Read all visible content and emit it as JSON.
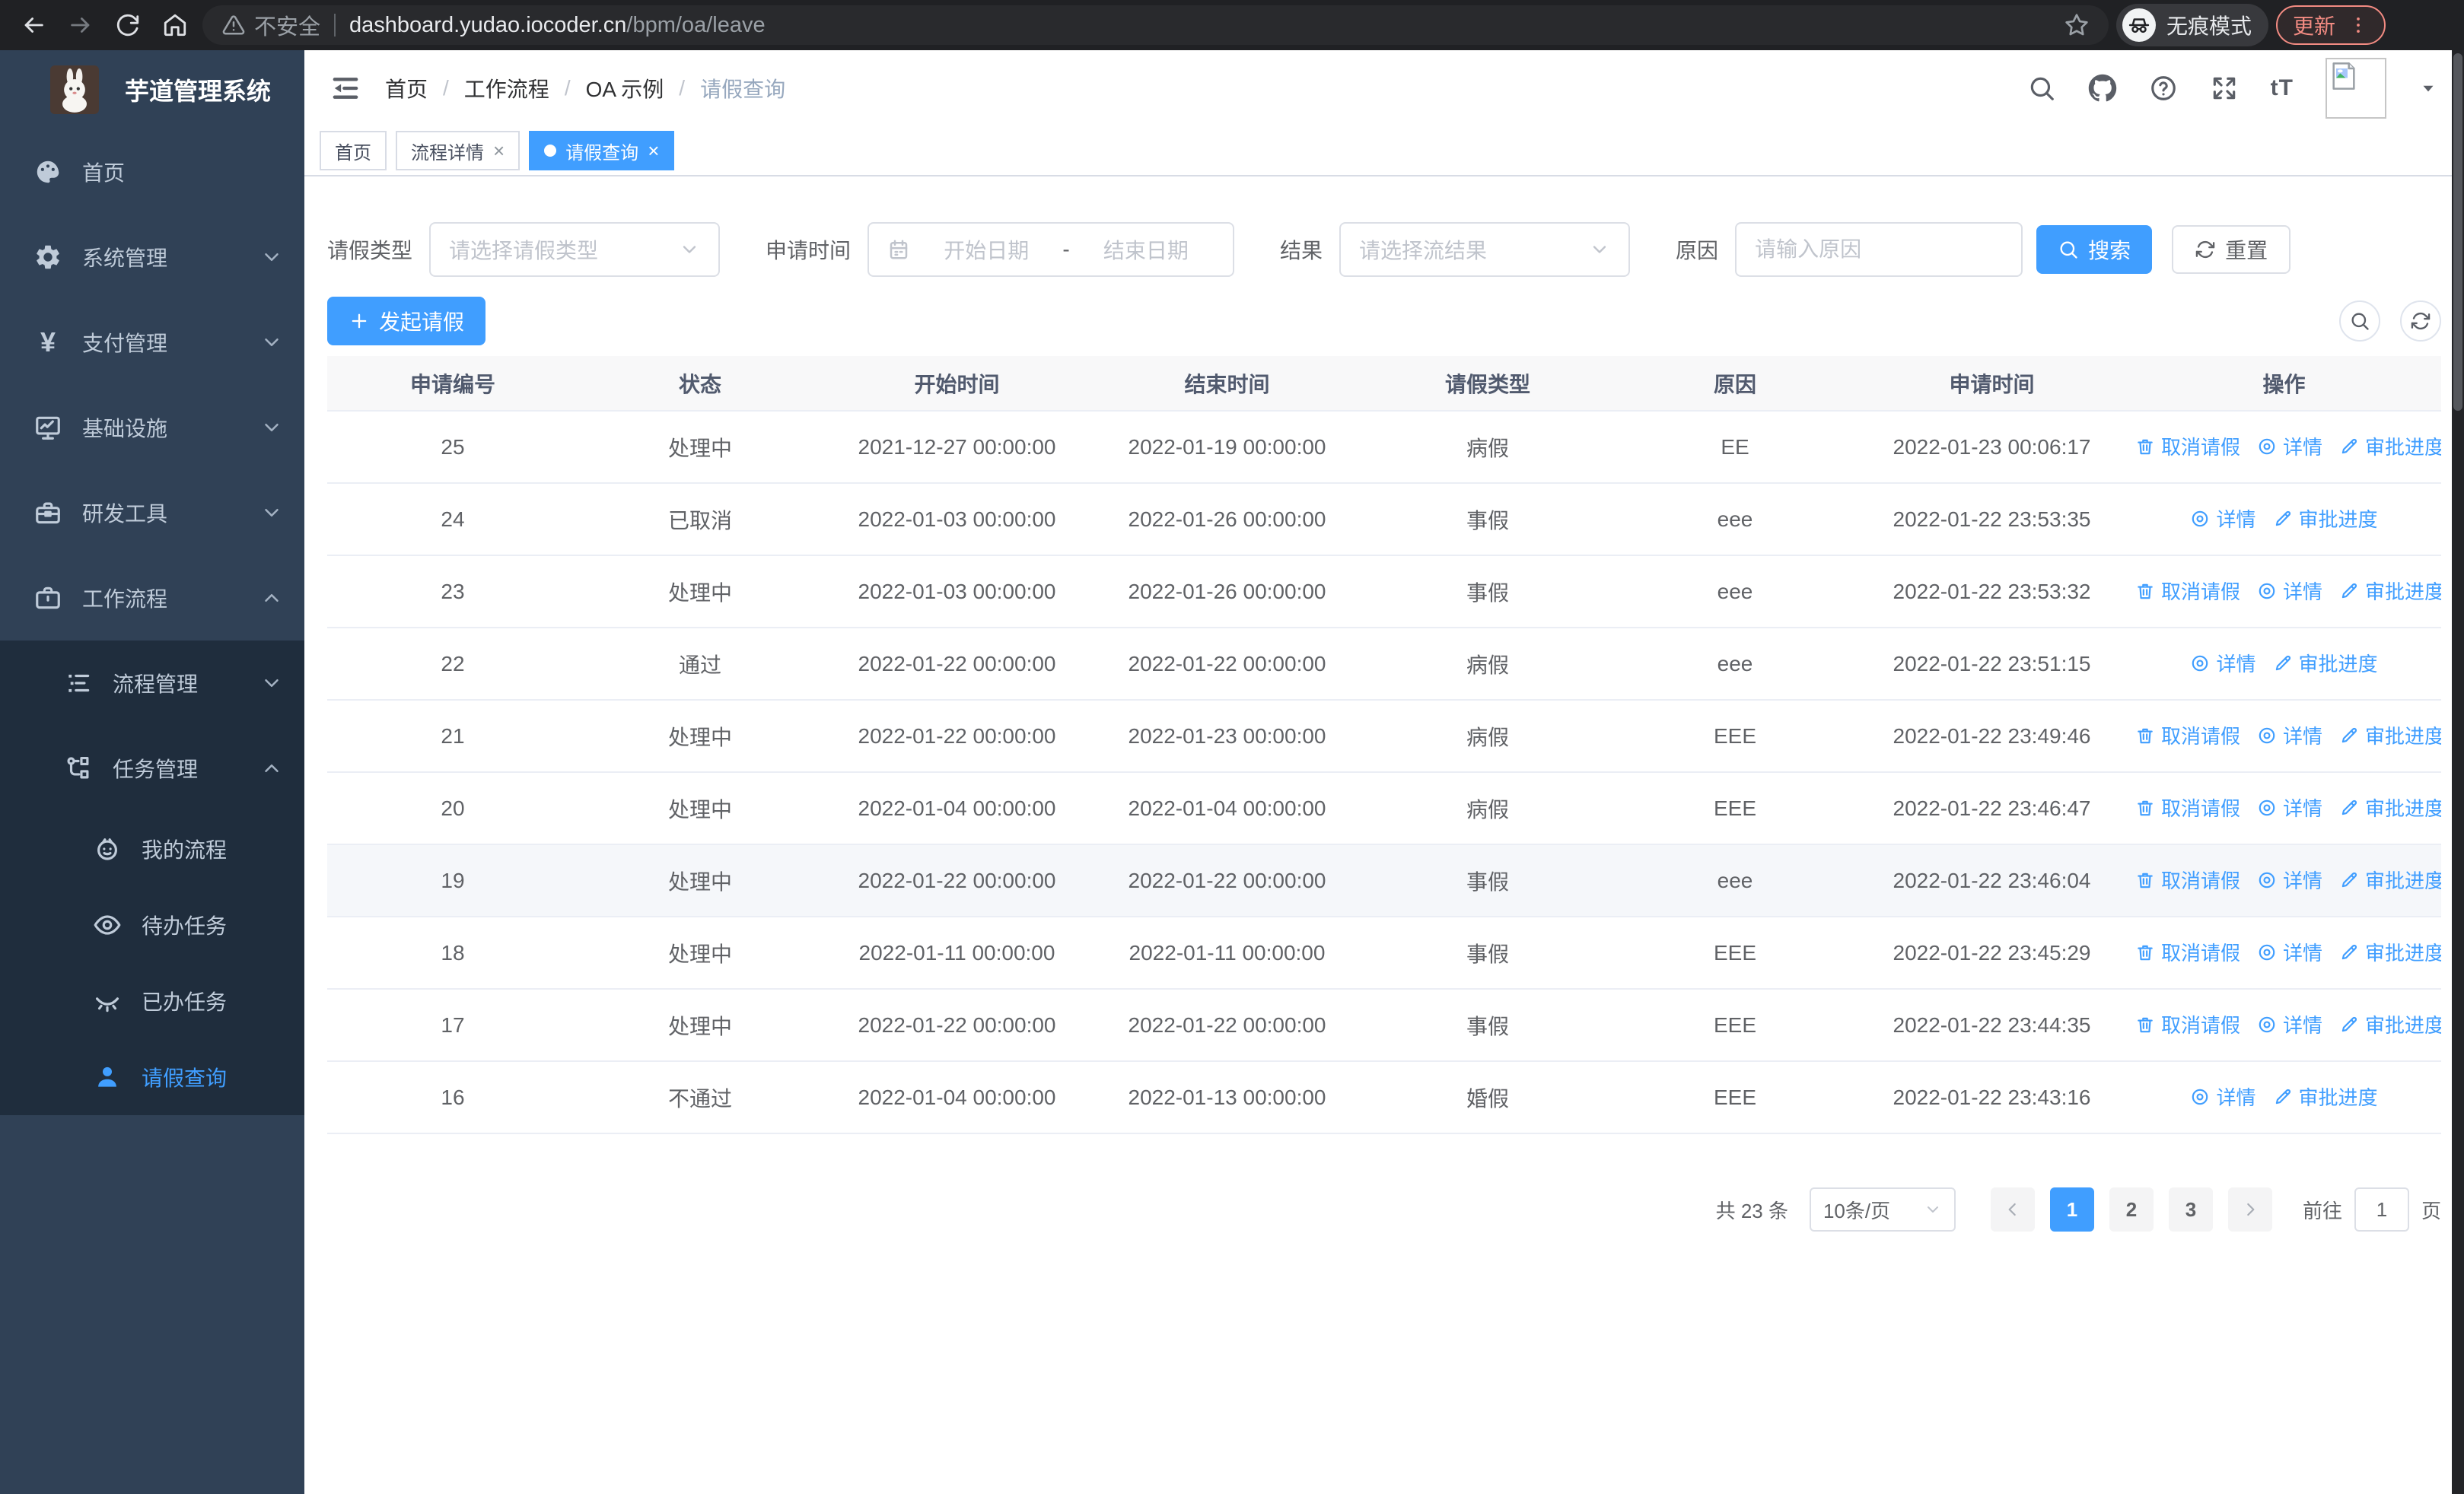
{
  "browser": {
    "security_label": "不安全",
    "url_host": "dashboard.yudao.iocoder.cn",
    "url_path": "/bpm/oa/leave",
    "incognito_label": "无痕模式",
    "update_label": "更新"
  },
  "sidebar": {
    "logo_title": "芋道管理系统",
    "menu": [
      {
        "key": "home",
        "label": "首页",
        "icon": "dashboard-icon",
        "level": 1
      },
      {
        "key": "system-management",
        "label": "系统管理",
        "icon": "gear-icon",
        "level": 1,
        "chevron": "down"
      },
      {
        "key": "payment-management",
        "label": "支付管理",
        "icon": "yen-icon",
        "level": 1,
        "chevron": "down"
      },
      {
        "key": "infrastructure",
        "label": "基础设施",
        "icon": "monitor-icon",
        "level": 1,
        "chevron": "down"
      },
      {
        "key": "dev-tools",
        "label": "研发工具",
        "icon": "toolbox-icon",
        "level": 1,
        "chevron": "down"
      },
      {
        "key": "workflow",
        "label": "工作流程",
        "icon": "briefcase-icon",
        "level": 1,
        "chevron": "up"
      },
      {
        "key": "process-management",
        "label": "流程管理",
        "icon": "list-icon",
        "level": 2,
        "chevron": "down",
        "dark": true
      },
      {
        "key": "task-management",
        "label": "任务管理",
        "icon": "flow-icon",
        "level": 2,
        "chevron": "up",
        "dark": true
      },
      {
        "key": "my-process",
        "label": "我的流程",
        "icon": "face-icon",
        "level": 3,
        "dark": true
      },
      {
        "key": "todo-tasks",
        "label": "待办任务",
        "icon": "eye-open-icon",
        "level": 3,
        "dark": true
      },
      {
        "key": "done-tasks",
        "label": "已办任务",
        "icon": "eye-closed-icon",
        "level": 3,
        "dark": true
      },
      {
        "key": "leave-query",
        "label": "请假查询",
        "icon": "user-icon",
        "level": 3,
        "dark": true,
        "active": true
      }
    ]
  },
  "breadcrumb": [
    "首页",
    "工作流程",
    "OA 示例",
    "请假查询"
  ],
  "tabs": [
    {
      "key": "home",
      "label": "首页",
      "closable": false,
      "active": false
    },
    {
      "key": "process-detail",
      "label": "流程详情",
      "closable": true,
      "active": false
    },
    {
      "key": "leave-query",
      "label": "请假查询",
      "closable": true,
      "active": true
    }
  ],
  "filters": {
    "leave_type_label": "请假类型",
    "leave_type_placeholder": "请选择请假类型",
    "apply_time_label": "申请时间",
    "start_date_placeholder": "开始日期",
    "range_separator": "-",
    "end_date_placeholder": "结束日期",
    "result_label": "结果",
    "result_placeholder": "请选择流结果",
    "reason_label": "原因",
    "reason_placeholder": "请输入原因",
    "search_label": "搜索",
    "reset_label": "重置"
  },
  "toolbar": {
    "create_label": "发起请假"
  },
  "table": {
    "columns": [
      "申请编号",
      "状态",
      "开始时间",
      "结束时间",
      "请假类型",
      "原因",
      "申请时间",
      "操作"
    ],
    "action_labels": {
      "cancel": "取消请假",
      "detail": "详情",
      "progress": "审批进度"
    },
    "rows": [
      {
        "id": "25",
        "status": "处理中",
        "start": "2021-12-27 00:00:00",
        "end": "2022-01-19 00:00:00",
        "type": "病假",
        "reason": "EE",
        "applied": "2022-01-23 00:06:17",
        "actions": [
          "cancel",
          "detail",
          "progress"
        ],
        "highlight": false
      },
      {
        "id": "24",
        "status": "已取消",
        "start": "2022-01-03 00:00:00",
        "end": "2022-01-26 00:00:00",
        "type": "事假",
        "reason": "eee",
        "applied": "2022-01-22 23:53:35",
        "actions": [
          "detail",
          "progress"
        ],
        "highlight": false
      },
      {
        "id": "23",
        "status": "处理中",
        "start": "2022-01-03 00:00:00",
        "end": "2022-01-26 00:00:00",
        "type": "事假",
        "reason": "eee",
        "applied": "2022-01-22 23:53:32",
        "actions": [
          "cancel",
          "detail",
          "progress"
        ],
        "highlight": false
      },
      {
        "id": "22",
        "status": "通过",
        "start": "2022-01-22 00:00:00",
        "end": "2022-01-22 00:00:00",
        "type": "病假",
        "reason": "eee",
        "applied": "2022-01-22 23:51:15",
        "actions": [
          "detail",
          "progress"
        ],
        "highlight": false
      },
      {
        "id": "21",
        "status": "处理中",
        "start": "2022-01-22 00:00:00",
        "end": "2022-01-23 00:00:00",
        "type": "病假",
        "reason": "EEE",
        "applied": "2022-01-22 23:49:46",
        "actions": [
          "cancel",
          "detail",
          "progress"
        ],
        "highlight": false
      },
      {
        "id": "20",
        "status": "处理中",
        "start": "2022-01-04 00:00:00",
        "end": "2022-01-04 00:00:00",
        "type": "病假",
        "reason": "EEE",
        "applied": "2022-01-22 23:46:47",
        "actions": [
          "cancel",
          "detail",
          "progress"
        ],
        "highlight": false
      },
      {
        "id": "19",
        "status": "处理中",
        "start": "2022-01-22 00:00:00",
        "end": "2022-01-22 00:00:00",
        "type": "事假",
        "reason": "eee",
        "applied": "2022-01-22 23:46:04",
        "actions": [
          "cancel",
          "detail",
          "progress"
        ],
        "highlight": true
      },
      {
        "id": "18",
        "status": "处理中",
        "start": "2022-01-11 00:00:00",
        "end": "2022-01-11 00:00:00",
        "type": "事假",
        "reason": "EEE",
        "applied": "2022-01-22 23:45:29",
        "actions": [
          "cancel",
          "detail",
          "progress"
        ],
        "highlight": false
      },
      {
        "id": "17",
        "status": "处理中",
        "start": "2022-01-22 00:00:00",
        "end": "2022-01-22 00:00:00",
        "type": "事假",
        "reason": "EEE",
        "applied": "2022-01-22 23:44:35",
        "actions": [
          "cancel",
          "detail",
          "progress"
        ],
        "highlight": false
      },
      {
        "id": "16",
        "status": "不通过",
        "start": "2022-01-04 00:00:00",
        "end": "2022-01-13 00:00:00",
        "type": "婚假",
        "reason": "EEE",
        "applied": "2022-01-22 23:43:16",
        "actions": [
          "detail",
          "progress"
        ],
        "highlight": false
      }
    ]
  },
  "pagination": {
    "total_label": "共 23 条",
    "page_size": "10条/页",
    "pages": [
      "1",
      "2",
      "3"
    ],
    "active_page": "1",
    "goto_label": "前往",
    "goto_value": "1",
    "page_suffix_label": "页"
  },
  "colors": {
    "accent": "#409EFF",
    "sidebar_bg": "#304156",
    "submenu_bg": "#1f2d3d",
    "update_red": "#f28b82",
    "link_blue": "#409EFF"
  }
}
